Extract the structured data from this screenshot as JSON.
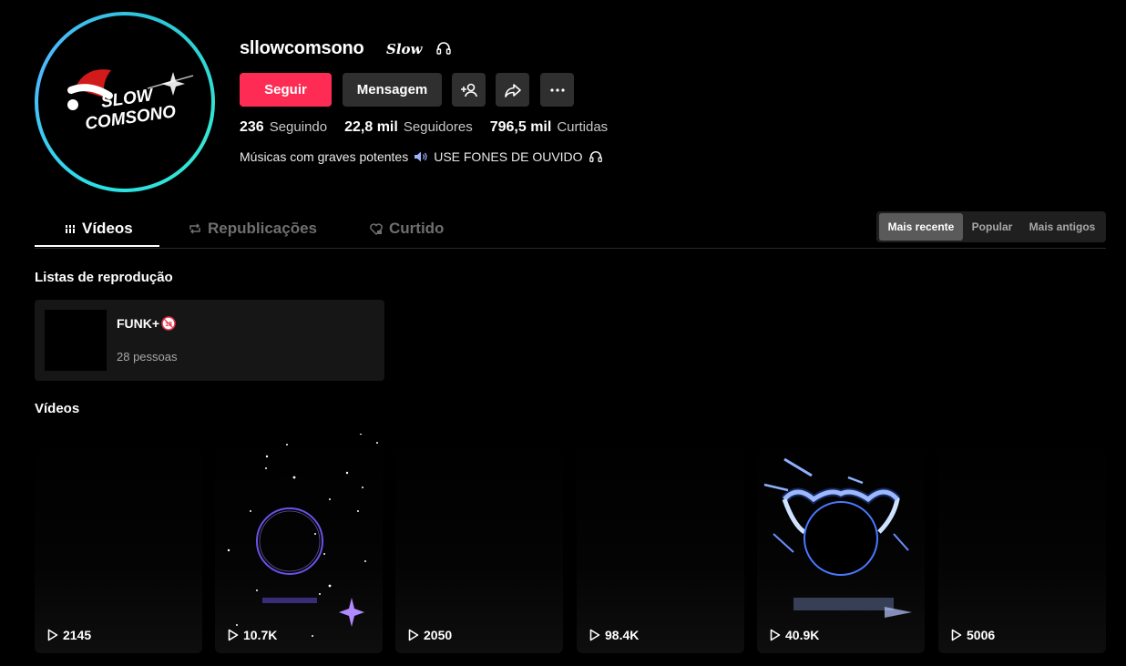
{
  "profile": {
    "username": "sllowcomsono",
    "nickname": "Slow",
    "avatar_text_line1": "SLOW",
    "avatar_text_line2": "COMSONO"
  },
  "actions": {
    "follow_label": "Seguir",
    "message_label": "Mensagem"
  },
  "stats": [
    {
      "value": "236",
      "label": "Seguindo"
    },
    {
      "value": "22,8 mil",
      "label": "Seguidores"
    },
    {
      "value": "796,5 mil",
      "label": "Curtidas"
    }
  ],
  "bio": {
    "part1": "Músicas com graves potentes",
    "part2": "USE FONES DE OUVIDO"
  },
  "tabs": [
    {
      "label": "Vídeos",
      "icon": "grid-icon",
      "active": true
    },
    {
      "label": "Republicações",
      "icon": "repost-icon"
    },
    {
      "label": "Curtido",
      "icon": "heart-lock-icon"
    }
  ],
  "sort": {
    "options": [
      "Mais recente",
      "Popular",
      "Mais antigos"
    ],
    "selected": "Mais recente"
  },
  "playlists": {
    "title": "Listas de reprodução",
    "items": [
      {
        "name": "FUNK+",
        "badge": "18",
        "count": "28 pessoas"
      }
    ]
  },
  "videos": {
    "title": "Vídeos",
    "items": [
      {
        "views": "2145"
      },
      {
        "views": "10.7K"
      },
      {
        "views": "2050"
      },
      {
        "views": "98.4K"
      },
      {
        "views": "40.9K"
      },
      {
        "views": "5006"
      }
    ]
  },
  "colors": {
    "accent": "#fe2c55",
    "avatar_ring": "#29e0e6",
    "background": "#000000"
  }
}
